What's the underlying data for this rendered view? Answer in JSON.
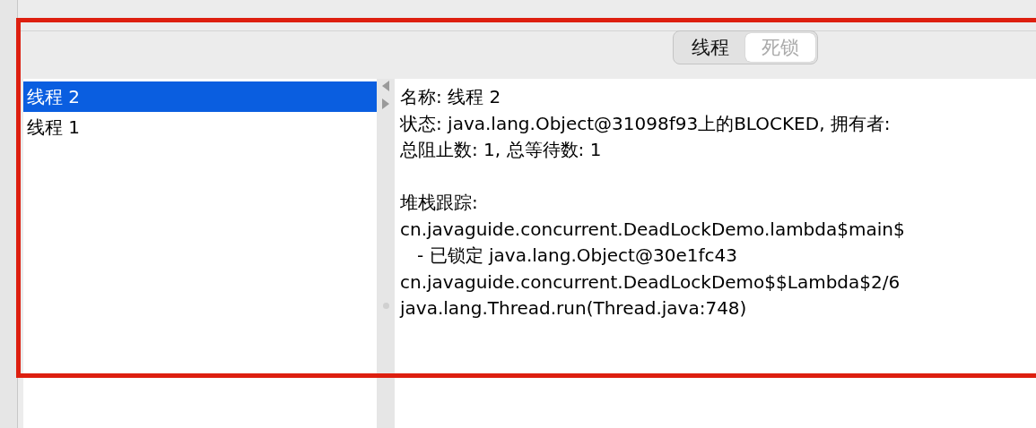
{
  "tabs": [
    {
      "label": "线程",
      "selected": false
    },
    {
      "label": "死锁",
      "selected": true
    }
  ],
  "thread_list": [
    {
      "label": "线程 2",
      "selected": true
    },
    {
      "label": "线程 1",
      "selected": false
    }
  ],
  "details": {
    "info_lines": [
      "名称: 线程 2",
      "状态: java.lang.Object@31098f93上的BLOCKED, 拥有者:",
      "总阻止数: 1, 总等待数: 1"
    ],
    "stack_lines": [
      "堆栈跟踪:",
      "cn.javaguide.concurrent.DeadLockDemo.lambda$main$",
      "   - 已锁定 java.lang.Object@30e1fc43",
      "cn.javaguide.concurrent.DeadLockDemo$$Lambda$2/6",
      "java.lang.Thread.run(Thread.java:748)"
    ]
  }
}
